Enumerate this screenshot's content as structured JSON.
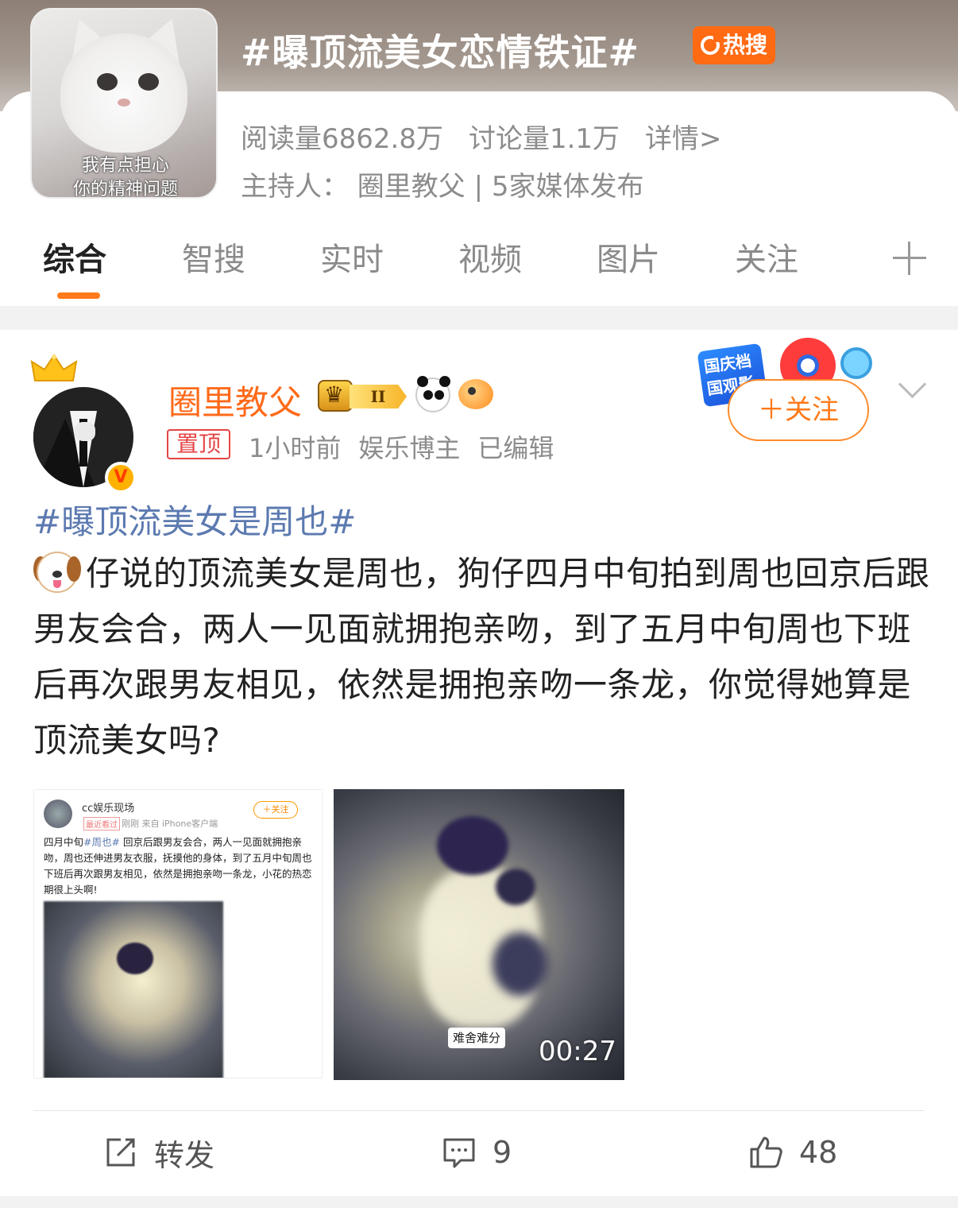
{
  "topic": {
    "title": "#曝顶流美女恋情铁证#",
    "hot_badge": "热搜",
    "thumb_caption_line1": "我有点担心",
    "thumb_caption_line2": "你的精神问题",
    "reads": "阅读量6862.8万",
    "discussions": "讨论量1.1万",
    "details": "详情>",
    "host": "主持人：  圈里教父 | 5家媒体发布"
  },
  "tabs": [
    "综合",
    "智搜",
    "实时",
    "视频",
    "图片",
    "关注"
  ],
  "post": {
    "author": "圈里教父",
    "vip_rank": "II",
    "pin_label": "置顶",
    "time": "1小时前",
    "author_type": "娱乐博主",
    "edited": "已编辑",
    "promo_sign": "国庆档 国观影",
    "follow_label": "＋关注",
    "hashtag": "#曝顶流美女是周也#",
    "text": "仔说的顶流美女是周也，狗仔四月中旬拍到周也回京后跟男友会合，两人一见面就拥抱亲吻，到了五月中旬周也下班后再次跟男友相见，依然是拥抱亲吻一条龙，你觉得她算是顶流美女吗?",
    "image1": {
      "name": "cc娱乐现场",
      "tag": "最近看过",
      "meta": "刚刚  来自 iPhone客户端",
      "follow": "＋关注",
      "text_prefix": "四月中旬",
      "text_link": "#周也#",
      "text_rest": " 回京后跟男友会合，两人一见面就拥抱亲吻，周也还伸进男友衣服，抚摸他的身体，到了五月中旬周也下班后再次跟男友相见，依然是拥抱亲吻一条龙，小花的热恋期很上头啊!"
    },
    "video": {
      "subtitle": "难舍难分",
      "duration": "00:27"
    },
    "actions": {
      "repost": "转发",
      "comments": "9",
      "likes": "48"
    }
  },
  "colors": {
    "accent": "#ff7a1a",
    "hot_badge": "#ff6a13",
    "hashtag": "#5c7ab0",
    "pin": "#e54545"
  }
}
